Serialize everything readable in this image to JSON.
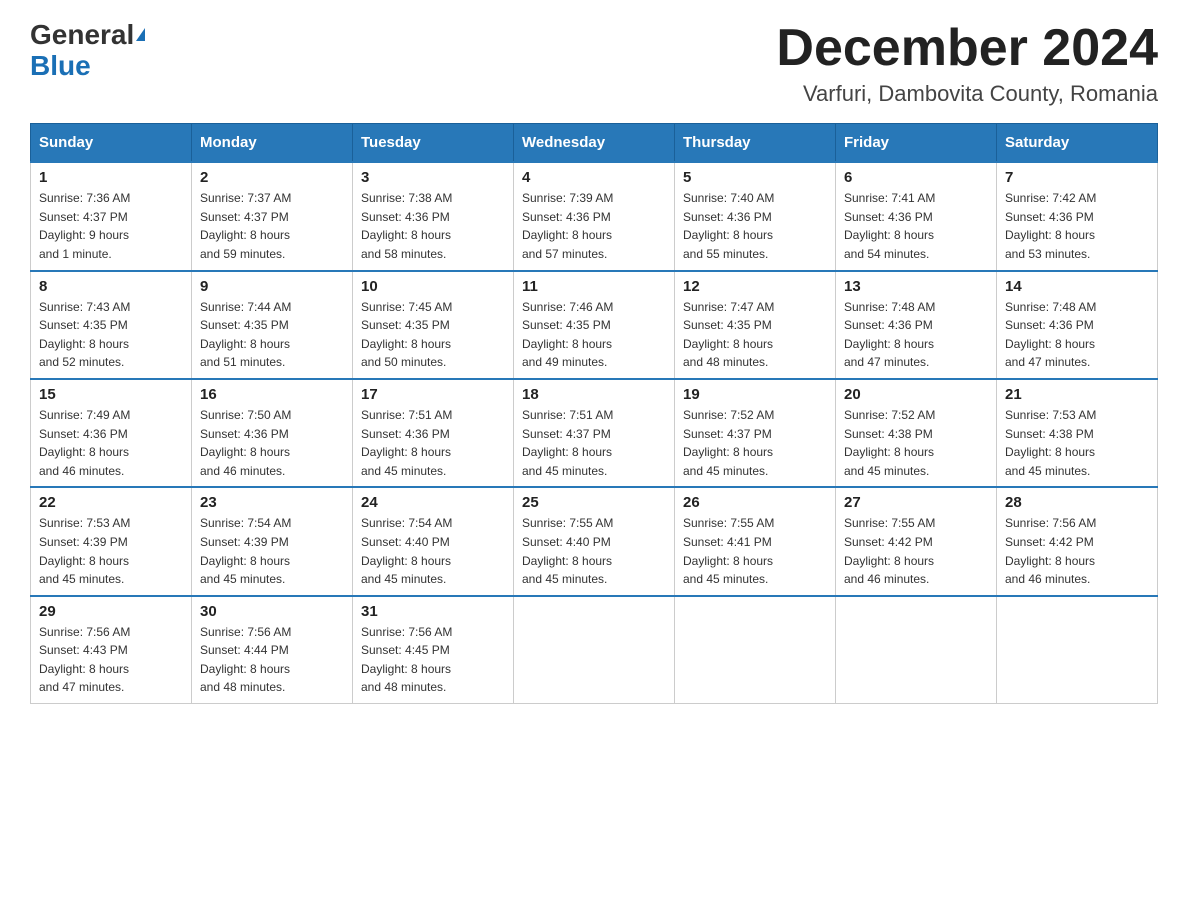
{
  "header": {
    "title": "December 2024",
    "subtitle": "Varfuri, Dambovita County, Romania",
    "logo_general": "General",
    "logo_blue": "Blue"
  },
  "days_of_week": [
    "Sunday",
    "Monday",
    "Tuesday",
    "Wednesday",
    "Thursday",
    "Friday",
    "Saturday"
  ],
  "weeks": [
    [
      {
        "day": "1",
        "sunrise": "7:36 AM",
        "sunset": "4:37 PM",
        "daylight": "9 hours and 1 minute."
      },
      {
        "day": "2",
        "sunrise": "7:37 AM",
        "sunset": "4:37 PM",
        "daylight": "8 hours and 59 minutes."
      },
      {
        "day": "3",
        "sunrise": "7:38 AM",
        "sunset": "4:36 PM",
        "daylight": "8 hours and 58 minutes."
      },
      {
        "day": "4",
        "sunrise": "7:39 AM",
        "sunset": "4:36 PM",
        "daylight": "8 hours and 57 minutes."
      },
      {
        "day": "5",
        "sunrise": "7:40 AM",
        "sunset": "4:36 PM",
        "daylight": "8 hours and 55 minutes."
      },
      {
        "day": "6",
        "sunrise": "7:41 AM",
        "sunset": "4:36 PM",
        "daylight": "8 hours and 54 minutes."
      },
      {
        "day": "7",
        "sunrise": "7:42 AM",
        "sunset": "4:36 PM",
        "daylight": "8 hours and 53 minutes."
      }
    ],
    [
      {
        "day": "8",
        "sunrise": "7:43 AM",
        "sunset": "4:35 PM",
        "daylight": "8 hours and 52 minutes."
      },
      {
        "day": "9",
        "sunrise": "7:44 AM",
        "sunset": "4:35 PM",
        "daylight": "8 hours and 51 minutes."
      },
      {
        "day": "10",
        "sunrise": "7:45 AM",
        "sunset": "4:35 PM",
        "daylight": "8 hours and 50 minutes."
      },
      {
        "day": "11",
        "sunrise": "7:46 AM",
        "sunset": "4:35 PM",
        "daylight": "8 hours and 49 minutes."
      },
      {
        "day": "12",
        "sunrise": "7:47 AM",
        "sunset": "4:35 PM",
        "daylight": "8 hours and 48 minutes."
      },
      {
        "day": "13",
        "sunrise": "7:48 AM",
        "sunset": "4:36 PM",
        "daylight": "8 hours and 47 minutes."
      },
      {
        "day": "14",
        "sunrise": "7:48 AM",
        "sunset": "4:36 PM",
        "daylight": "8 hours and 47 minutes."
      }
    ],
    [
      {
        "day": "15",
        "sunrise": "7:49 AM",
        "sunset": "4:36 PM",
        "daylight": "8 hours and 46 minutes."
      },
      {
        "day": "16",
        "sunrise": "7:50 AM",
        "sunset": "4:36 PM",
        "daylight": "8 hours and 46 minutes."
      },
      {
        "day": "17",
        "sunrise": "7:51 AM",
        "sunset": "4:36 PM",
        "daylight": "8 hours and 45 minutes."
      },
      {
        "day": "18",
        "sunrise": "7:51 AM",
        "sunset": "4:37 PM",
        "daylight": "8 hours and 45 minutes."
      },
      {
        "day": "19",
        "sunrise": "7:52 AM",
        "sunset": "4:37 PM",
        "daylight": "8 hours and 45 minutes."
      },
      {
        "day": "20",
        "sunrise": "7:52 AM",
        "sunset": "4:38 PM",
        "daylight": "8 hours and 45 minutes."
      },
      {
        "day": "21",
        "sunrise": "7:53 AM",
        "sunset": "4:38 PM",
        "daylight": "8 hours and 45 minutes."
      }
    ],
    [
      {
        "day": "22",
        "sunrise": "7:53 AM",
        "sunset": "4:39 PM",
        "daylight": "8 hours and 45 minutes."
      },
      {
        "day": "23",
        "sunrise": "7:54 AM",
        "sunset": "4:39 PM",
        "daylight": "8 hours and 45 minutes."
      },
      {
        "day": "24",
        "sunrise": "7:54 AM",
        "sunset": "4:40 PM",
        "daylight": "8 hours and 45 minutes."
      },
      {
        "day": "25",
        "sunrise": "7:55 AM",
        "sunset": "4:40 PM",
        "daylight": "8 hours and 45 minutes."
      },
      {
        "day": "26",
        "sunrise": "7:55 AM",
        "sunset": "4:41 PM",
        "daylight": "8 hours and 45 minutes."
      },
      {
        "day": "27",
        "sunrise": "7:55 AM",
        "sunset": "4:42 PM",
        "daylight": "8 hours and 46 minutes."
      },
      {
        "day": "28",
        "sunrise": "7:56 AM",
        "sunset": "4:42 PM",
        "daylight": "8 hours and 46 minutes."
      }
    ],
    [
      {
        "day": "29",
        "sunrise": "7:56 AM",
        "sunset": "4:43 PM",
        "daylight": "8 hours and 47 minutes."
      },
      {
        "day": "30",
        "sunrise": "7:56 AM",
        "sunset": "4:44 PM",
        "daylight": "8 hours and 48 minutes."
      },
      {
        "day": "31",
        "sunrise": "7:56 AM",
        "sunset": "4:45 PM",
        "daylight": "8 hours and 48 minutes."
      },
      null,
      null,
      null,
      null
    ]
  ],
  "labels": {
    "sunrise": "Sunrise:",
    "sunset": "Sunset:",
    "daylight": "Daylight:"
  }
}
